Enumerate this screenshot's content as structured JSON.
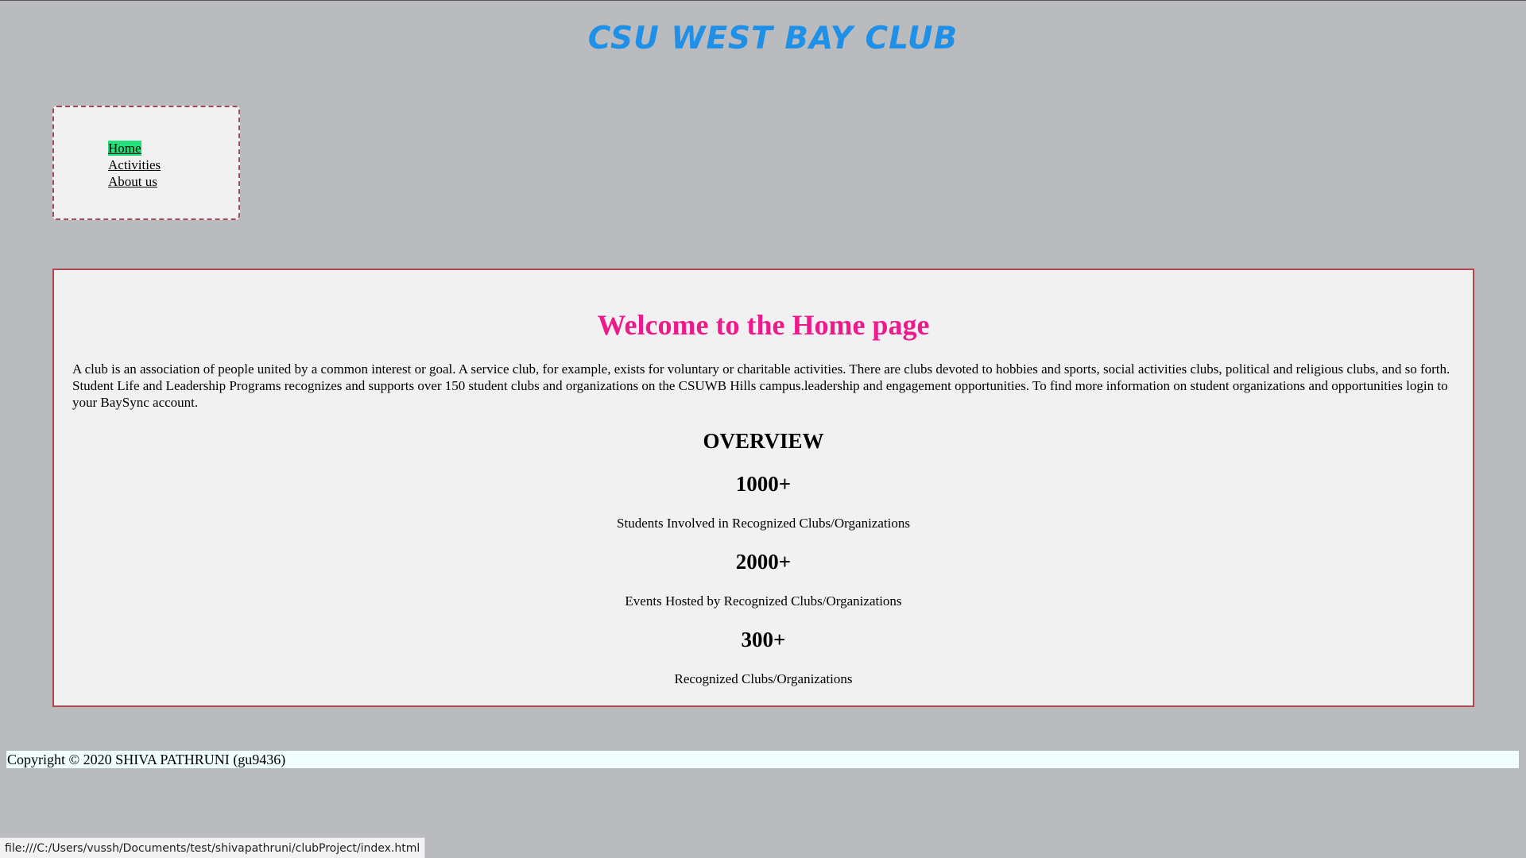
{
  "header": {
    "title": "CSU WEST BAY CLUB"
  },
  "nav": {
    "items": [
      {
        "label": "Home",
        "active": true
      },
      {
        "label": "Activities",
        "active": false
      },
      {
        "label": "About us",
        "active": false
      }
    ]
  },
  "main": {
    "heading": "Welcome to the Home page",
    "intro": "A club is an association of people united by a common interest or goal. A service club, for example, exists for voluntary or charitable activities. There are clubs devoted to hobbies and sports, social activities clubs, political and religious clubs, and so forth. Student Life and Leadership Programs recognizes and supports over 150 student clubs and organizations on the CSUWB Hills campus.leadership and engagement opportunities. To find more information on student organizations and opportunities login to your BaySync account.",
    "overview_title": "OVERVIEW",
    "stats": [
      {
        "value": "1000+",
        "label": "Students Involved in Recognized Clubs/Organizations"
      },
      {
        "value": "2000+",
        "label": "Events Hosted by Recognized Clubs/Organizations"
      },
      {
        "value": "300+",
        "label": "Recognized Clubs/Organizations"
      }
    ]
  },
  "footer": {
    "copyright": "Copyright © 2020 SHIVA PATHRUNI (gu9436)"
  },
  "status_bar": {
    "url": "file:///C:/Users/vussh/Documents/test/shivapathruni/clubProject/index.html"
  },
  "colors": {
    "page_background": "#babbbf",
    "title": "#1e90e8",
    "welcome_heading": "#ee1a8c",
    "active_nav_highlight": "#22e07a",
    "box_border": "#b04650",
    "footer_background": "#f0fefe"
  }
}
